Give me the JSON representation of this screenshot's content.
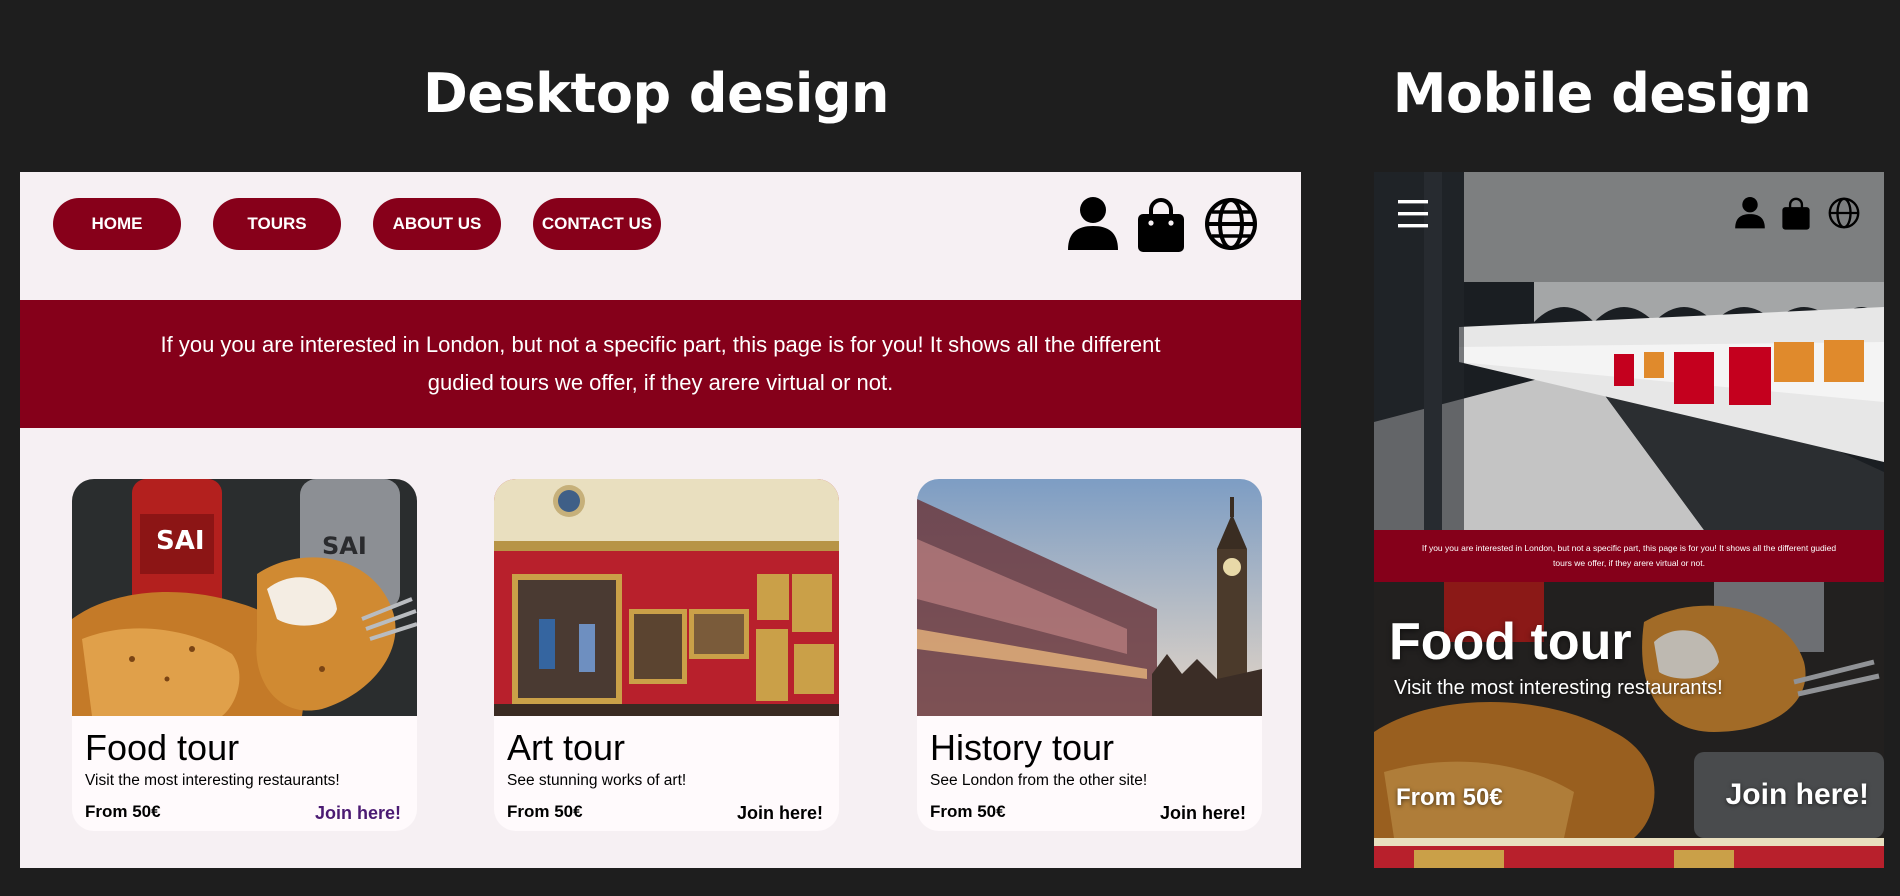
{
  "headings": {
    "desktop": "Desktop design",
    "mobile": "Mobile design"
  },
  "desktop": {
    "nav": [
      {
        "label": "HOME"
      },
      {
        "label": "TOURS"
      },
      {
        "label": "ABOUT US"
      },
      {
        "label": "CONTACT US"
      }
    ],
    "icons": [
      "user-icon",
      "shopping-bag-icon",
      "globe-icon"
    ],
    "banner_text": "If you you are interested in London, but not a specific part, this page is for you! It shows all the different gudied tours we offer, if they arere virtual or not.",
    "cards": [
      {
        "title": "Food tour",
        "description": "Visit the most interesting restaurants!",
        "price": "From 50€",
        "join": "Join here!",
        "image": "fried-fish-photo"
      },
      {
        "title": "Art tour",
        "description": "See stunning works of art!",
        "price": "From 50€",
        "join": "Join here!",
        "image": "art-gallery-photo"
      },
      {
        "title": "History tour",
        "description": "See London from the other site!",
        "price": "From 50€",
        "join": "Join here!",
        "image": "big-ben-photo"
      }
    ]
  },
  "mobile": {
    "icons": [
      "menu-icon",
      "user-icon",
      "shopping-bag-icon",
      "globe-icon"
    ],
    "hero_image": "london-underground-train-photo",
    "banner_text": "If you you are interested in London, but not a specific part, this page is for you! It shows all the different gudied tours we offer, if they arere virtual or not.",
    "card": {
      "title": "Food tour",
      "description": "Visit the most interesting restaurants!",
      "price": "From 50€",
      "join": "Join here!"
    }
  },
  "colors": {
    "background": "#1e1e1e",
    "brand_red": "#85001a",
    "page_background": "#f6f0f3",
    "card_background": "#fffafc",
    "visited_link": "#4b1a73"
  }
}
